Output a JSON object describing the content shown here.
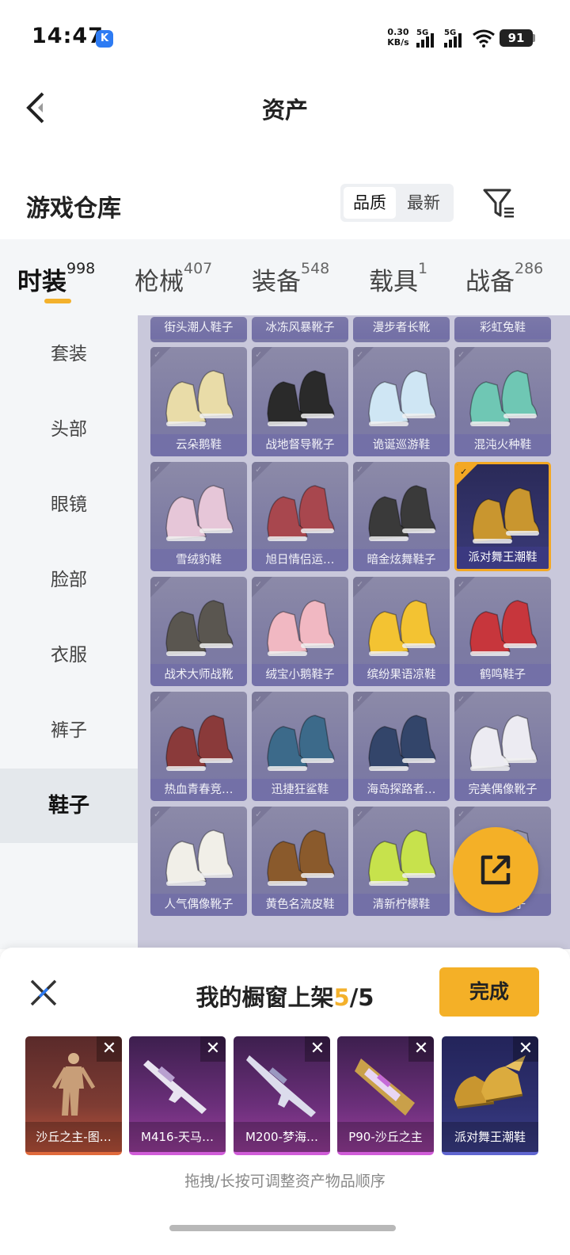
{
  "status_bar": {
    "time": "14:47",
    "app_badge": "K",
    "net_speed_value": "0.30",
    "net_speed_unit": "KB/s",
    "signal1_label": "5G",
    "signal2_label": "5G",
    "battery": "91"
  },
  "header": {
    "title": "资产"
  },
  "warehouse": {
    "title": "游戏仓库",
    "sort_quality": "品质",
    "sort_newest": "最新"
  },
  "categories": [
    {
      "name": "时装",
      "count": "998"
    },
    {
      "name": "枪械",
      "count": "407"
    },
    {
      "name": "装备",
      "count": "548"
    },
    {
      "name": "载具",
      "count": "1"
    },
    {
      "name": "战备",
      "count": "286"
    }
  ],
  "sidebar": [
    "套装",
    "头部",
    "眼镜",
    "脸部",
    "衣服",
    "裤子",
    "鞋子"
  ],
  "top_row": [
    "街头潮人鞋子",
    "冰冻风暴靴子",
    "漫步者长靴",
    "彩虹兔鞋"
  ],
  "items": [
    {
      "name": "云朵鹅鞋",
      "icon": "pastel-sneaker-icon",
      "color": "#e9dca8"
    },
    {
      "name": "战地督导靴子",
      "icon": "black-boot-icon",
      "color": "#2a2a2a"
    },
    {
      "name": "诡诞巡游鞋",
      "icon": "blue-slipon-icon",
      "color": "#cfe6f4"
    },
    {
      "name": "混沌火种鞋",
      "icon": "teal-sneaker-icon",
      "color": "#6fc7b4"
    },
    {
      "name": "雪绒豹鞋",
      "icon": "pink-boot-icon",
      "color": "#e6c6d8"
    },
    {
      "name": "旭日情侣运…",
      "icon": "red-hightop-icon",
      "color": "#a8474e"
    },
    {
      "name": "暗金炫舞鞋子",
      "icon": "dark-sneaker-icon",
      "color": "#3a3a3a"
    },
    {
      "name": "派对舞王潮鞋",
      "icon": "gold-winged-sneaker-icon",
      "color": "#c9962f"
    },
    {
      "name": "战术大师战靴",
      "icon": "grey-boot-icon",
      "color": "#5a5650"
    },
    {
      "name": "绒宝小鹅鞋子",
      "icon": "pink-slipper-icon",
      "color": "#f1b8c2"
    },
    {
      "name": "缤纷果语凉鞋",
      "icon": "yellow-sandal-icon",
      "color": "#f3c332"
    },
    {
      "name": "鹤鸣鞋子",
      "icon": "red-white-sneaker-icon",
      "color": "#c7363c"
    },
    {
      "name": "热血青春竞…",
      "icon": "maroon-hightop-icon",
      "color": "#8a3a3a"
    },
    {
      "name": "迅捷狂鲨鞋",
      "icon": "shark-sneaker-icon",
      "color": "#3c6a8a"
    },
    {
      "name": "海岛探路者…",
      "icon": "navy-sneaker-icon",
      "color": "#33456a"
    },
    {
      "name": "完美偶像靴子",
      "icon": "white-long-boot-icon",
      "color": "#ecebf2"
    },
    {
      "name": "人气偶像靴子",
      "icon": "white-boot-icon",
      "color": "#f1efe8"
    },
    {
      "name": "黄色名流皮鞋",
      "icon": "brown-shoe-icon",
      "color": "#8a5a2c"
    },
    {
      "name": "清新柠檬鞋",
      "icon": "lime-sneaker-icon",
      "color": "#c7e24c"
    },
    {
      "name": "青…靴子",
      "icon": "boot-icon",
      "color": "#9c9ab0"
    }
  ],
  "selected_item": "派对舞王潮鞋",
  "showcase": {
    "title_prefix": "我的橱窗上架",
    "current": "5",
    "sep_total": "/5",
    "done": "完成",
    "hint": "拖拽/长按可调整资产物品顺序",
    "items": [
      {
        "name": "沙丘之主-图…",
        "rarity": "red",
        "icon": "humanoid-figure-icon",
        "remove": "✕"
      },
      {
        "name": "M416-天马…",
        "rarity": "purple",
        "icon": "rifle-icon",
        "remove": "✕"
      },
      {
        "name": "M200-梦海…",
        "rarity": "purple",
        "icon": "sniper-rifle-icon",
        "remove": "✕"
      },
      {
        "name": "P90-沙丘之主",
        "rarity": "purple",
        "icon": "smg-icon",
        "remove": "✕"
      },
      {
        "name": "派对舞王潮鞋",
        "rarity": "blue",
        "icon": "gold-winged-sneaker-icon",
        "remove": "✕"
      }
    ]
  }
}
